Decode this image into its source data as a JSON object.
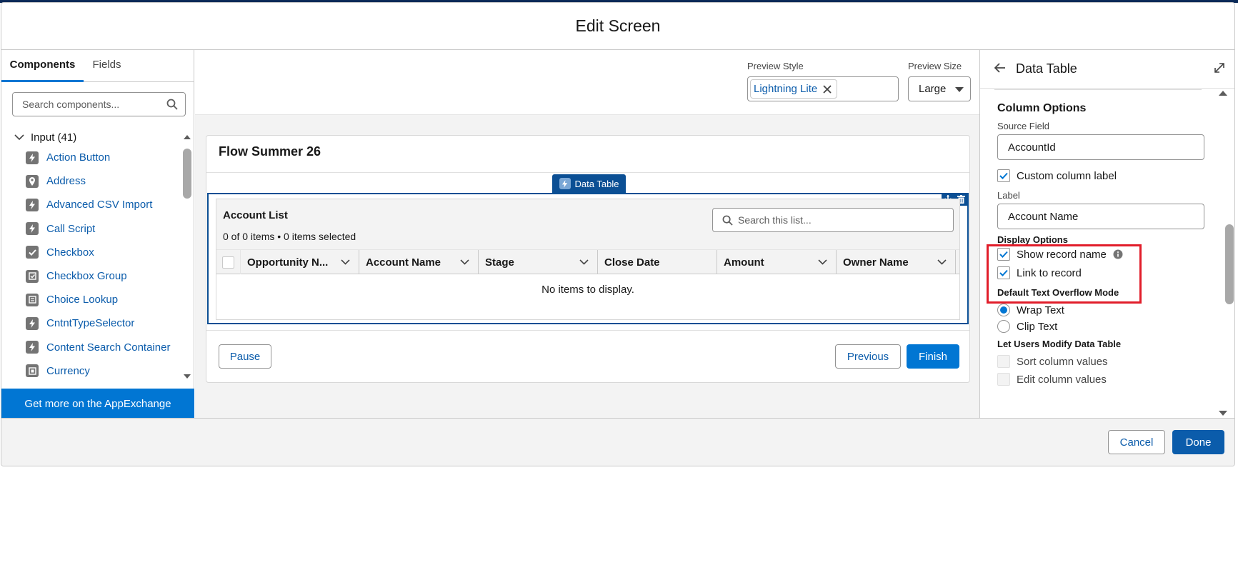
{
  "modal": {
    "title": "Edit Screen"
  },
  "left_panel": {
    "tabs": [
      {
        "label": "Components",
        "active": true
      },
      {
        "label": "Fields",
        "active": false
      }
    ],
    "search_placeholder": "Search components...",
    "group_label": "Input (41)",
    "components": [
      {
        "label": "Action Button",
        "icon": "lightning-icon"
      },
      {
        "label": "Address",
        "icon": "location-icon"
      },
      {
        "label": "Advanced CSV Import",
        "icon": "lightning-icon"
      },
      {
        "label": "Call Script",
        "icon": "lightning-icon"
      },
      {
        "label": "Checkbox",
        "icon": "checkbox-icon"
      },
      {
        "label": "Checkbox Group",
        "icon": "checkbox-group-icon"
      },
      {
        "label": "Choice Lookup",
        "icon": "lookup-icon"
      },
      {
        "label": "CntntTypeSelector",
        "icon": "lightning-icon"
      },
      {
        "label": "Content Search Container",
        "icon": "lightning-icon"
      },
      {
        "label": "Currency",
        "icon": "currency-icon"
      }
    ],
    "appexchange_label": "Get more on the AppExchange"
  },
  "canvas": {
    "preview_style_label": "Preview Style",
    "preview_style_value": "Lightning Lite",
    "preview_size_label": "Preview Size",
    "preview_size_value": "Large",
    "flow_title": "Flow Summer 26",
    "component_badge": "Data Table",
    "table": {
      "title": "Account List",
      "count_text": "0 of 0 items • 0 items selected",
      "search_placeholder": "Search this list...",
      "columns": [
        "Opportunity N...",
        "Account Name",
        "Stage",
        "Close Date",
        "Amount",
        "Owner Name"
      ],
      "empty_text": "No items to display."
    },
    "buttons": {
      "pause": "Pause",
      "previous": "Previous",
      "finish": "Finish"
    }
  },
  "right_panel": {
    "title": "Data Table",
    "column_options_heading": "Column Options",
    "source_field_label": "Source Field",
    "source_field_value": "AccountId",
    "custom_label_checkbox": {
      "label": "Custom column label",
      "checked": true
    },
    "label_label": "Label",
    "label_value": "Account Name",
    "display_options_heading": "Display Options",
    "show_record_name": {
      "label": "Show record name",
      "checked": true
    },
    "link_to_record": {
      "label": "Link to record",
      "checked": true
    },
    "overflow_heading": "Default Text Overflow Mode",
    "wrap_text": {
      "label": "Wrap Text",
      "selected": true
    },
    "clip_text": {
      "label": "Clip Text",
      "selected": false
    },
    "modify_heading": "Let Users Modify Data Table",
    "sort_values": {
      "label": "Sort column values",
      "checked": false
    },
    "edit_values": {
      "label": "Edit column values",
      "checked": false
    }
  },
  "footer": {
    "cancel": "Cancel",
    "done": "Done"
  },
  "colors": {
    "brand": "#0176d3",
    "link": "#0b5cab",
    "badge": "#0b4f94",
    "highlight": "#e11d2a",
    "top_strip": "#0b2a58"
  }
}
